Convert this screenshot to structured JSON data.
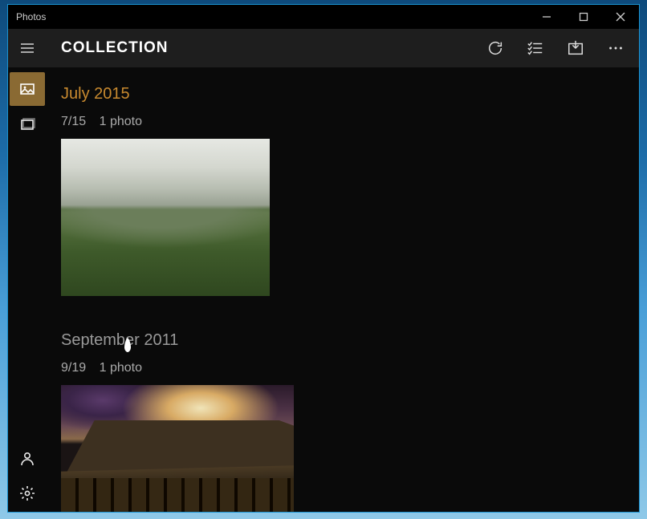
{
  "window": {
    "title": "Photos"
  },
  "commandbar": {
    "page_title": "COLLECTION"
  },
  "groups": [
    {
      "title": "July 2015",
      "date": "7/15",
      "count": "1 photo",
      "highlighted": true
    },
    {
      "title": "September 2011",
      "date": "9/19",
      "count": "1 photo",
      "highlighted": false
    }
  ]
}
